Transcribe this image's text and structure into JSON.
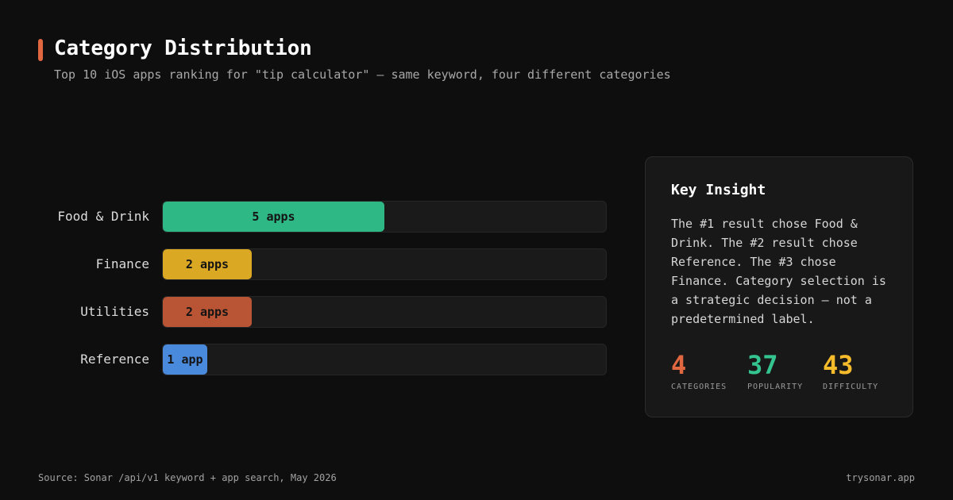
{
  "header": {
    "title": "Category Distribution",
    "subtitle": "Top 10 iOS apps ranking for \"tip calculator\" — same keyword, four different categories"
  },
  "chart_data": {
    "type": "bar",
    "orientation": "horizontal",
    "categories": [
      "Food & Drink",
      "Finance",
      "Utilities",
      "Reference"
    ],
    "values": [
      5,
      2,
      2,
      1
    ],
    "value_labels": [
      "5 apps",
      "2 apps",
      "2 apps",
      "1 app"
    ],
    "colors": [
      "#2eb886",
      "#dba823",
      "#b95534",
      "#4a8add"
    ],
    "xlim": [
      0,
      10
    ],
    "grid": false
  },
  "insight": {
    "title": "Key Insight",
    "body": "The #1 result chose Food & Drink. The #2 result chose Reference. The #3 chose Finance. Category selection is a strategic decision — not a predetermined label.",
    "stats": [
      {
        "value": "4",
        "label": "CATEGORIES",
        "color": "#e0673f"
      },
      {
        "value": "37",
        "label": "POPULARITY",
        "color": "#34c490"
      },
      {
        "value": "43",
        "label": "DIFFICULTY",
        "color": "#f5bb2b"
      }
    ]
  },
  "footer": {
    "source": "Source: Sonar /api/v1 keyword + app search, May 2026",
    "site": "trysonar.app"
  }
}
